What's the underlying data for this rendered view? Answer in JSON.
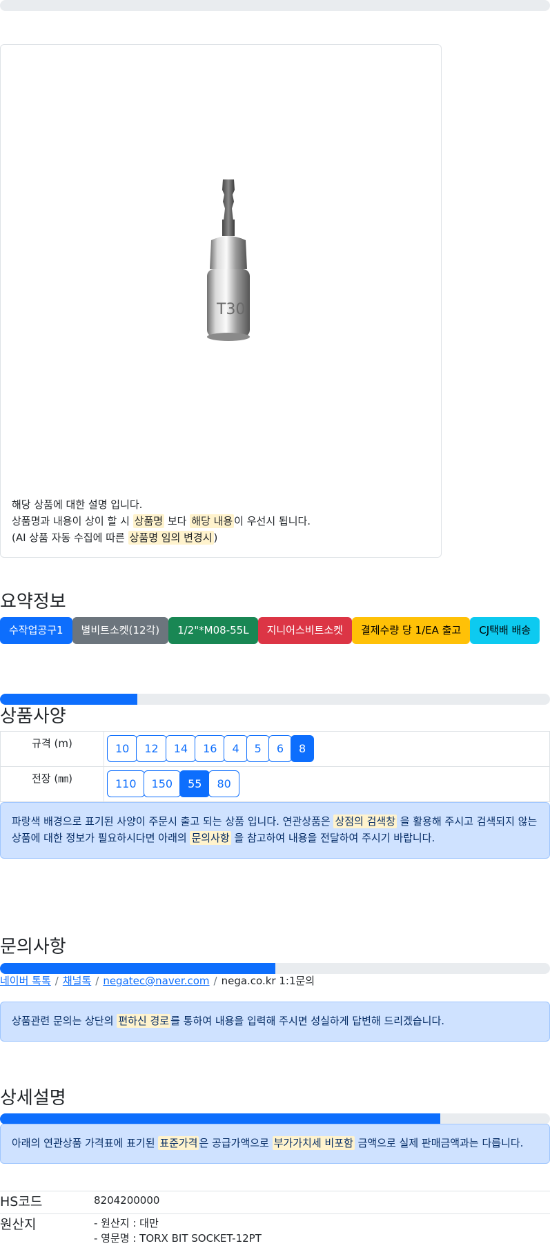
{
  "top_progress": {
    "fraction": 0
  },
  "product": {
    "desc_line1": "해당 상품에 대한 설명 입니다.",
    "desc_line2_a": "상품명과 내용이 상이 할 시 ",
    "desc_line2_hl1": "상품명",
    "desc_line2_b": " 보다 ",
    "desc_line2_hl2": "해당 내용",
    "desc_line2_c": "이 우선시 됩니다.",
    "desc_line3_a": "(AI 상품 자동 수집에 따른 ",
    "desc_line3_hl": "상품명 임의 변경시",
    "desc_line3_b": ")",
    "image_engraving": "T30"
  },
  "summary": {
    "title": "요약정보",
    "badges": [
      {
        "label": "수작업공구1",
        "bg": "#0d6efd",
        "fg": "#ffffff"
      },
      {
        "label": "별비트소켓(12각)",
        "bg": "#6c757d",
        "fg": "#ffffff"
      },
      {
        "label": "1/2\"*M08-55L",
        "bg": "#198754",
        "fg": "#ffffff"
      },
      {
        "label": "지니어스비트소켓",
        "bg": "#dc3545",
        "fg": "#ffffff"
      },
      {
        "label": "결제수량 당 1/EA 출고",
        "bg": "#ffc107",
        "fg": "#000000"
      },
      {
        "label": "CJ택배 배송",
        "bg": "#0dcaf0",
        "fg": "#000000"
      }
    ]
  },
  "spec": {
    "progress_fraction": 0.25,
    "title": "상품사양",
    "rows": [
      {
        "label": "규격 (m)",
        "options": [
          "10",
          "12",
          "14",
          "16",
          "4",
          "5",
          "6",
          "8"
        ],
        "selected": "8"
      },
      {
        "label": "전장 (㎜)",
        "options": [
          "110",
          "150",
          "55",
          "80"
        ],
        "selected": "55"
      }
    ],
    "notice_a": "파랑색 배경으로 표기된 사양이 주문시 출고 되는 상품 입니다. 연관상품은 ",
    "notice_hl1": "상점의 검색창",
    "notice_b": " 을 활용해 주시고 검색되지 않는 상품에 대한 정보가 필요하시다면 아래의 ",
    "notice_hl2": "문의사항",
    "notice_c": " 을 참고하여 내용을 전달하여 주시기 바랍니다."
  },
  "inquiry": {
    "title": "문의사항",
    "progress_fraction": 0.5,
    "links": [
      "네이버 톡톡",
      "채널톡",
      "negatec@naver.com"
    ],
    "plain": "nega.co.kr 1:1문의",
    "separator": "/",
    "notice_a": "상품관련 문의는 상단의 ",
    "notice_hl": "편하신 경로",
    "notice_b": "를 통하여 내용을 입력해 주시면 성실하게 답변해 드리겠습니다."
  },
  "detail": {
    "title": "상세설명",
    "progress_fraction": 0.8,
    "notice_a": "아래의 연관상품 가격표에 표기된 ",
    "notice_hl1": "표준가격",
    "notice_b": "은 공급가액으로 ",
    "notice_hl2": "부가가치세 비포함",
    "notice_c": " 금액으로 실제 판매금액과는 다릅니다.",
    "info": [
      {
        "key": "HS코드",
        "lines": [
          "8204200000"
        ]
      },
      {
        "key": "원산지",
        "lines": [
          "- 원산지 : 대만",
          "- 영문명 : TORX BIT SOCKET-12PT"
        ]
      }
    ]
  }
}
